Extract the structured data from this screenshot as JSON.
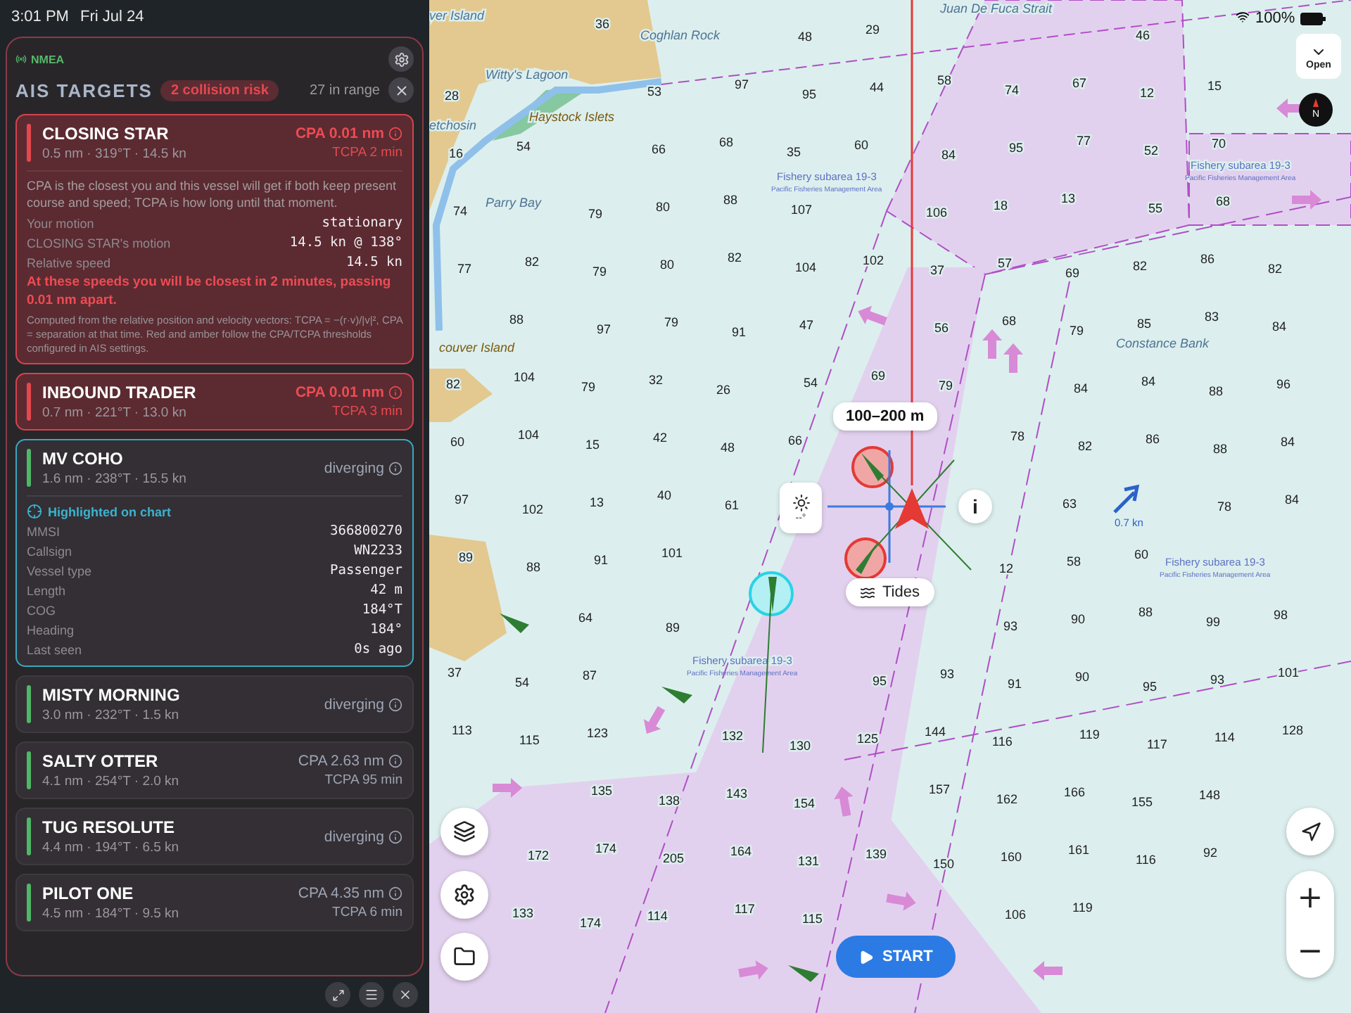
{
  "status_bar": {
    "time": "3:01 PM",
    "date": "Fri Jul 24",
    "battery": "100%"
  },
  "panel": {
    "source": "NMEA",
    "title": "AIS TARGETS",
    "risk_badge": "2 collision risk",
    "range_count": "27 in range"
  },
  "targets": [
    {
      "name": "CLOSING STAR",
      "summary": "0.5 nm · 319°T · 14.5 kn",
      "alert": true,
      "selected": false,
      "cpa": "CPA 0.01 nm",
      "tcpa": "TCPA 2 min",
      "details": {
        "note": "CPA is the closest you and this vessel will get if both keep present course and speed; TCPA is how long until that moment.",
        "rows": [
          {
            "label": "Your motion",
            "value": "stationary"
          },
          {
            "label": "CLOSING STAR's motion",
            "value": "14.5 kn @ 138°"
          },
          {
            "label": "Relative speed",
            "value": "14.5 kn"
          }
        ],
        "warning": "At these speeds you will be closest in 2 minutes, passing 0.01 nm apart.",
        "footnote": "Computed from the relative position and velocity vectors: TCPA = −(r·v)/|v|², CPA = separation at that time. Red and amber follow the CPA/TCPA thresholds configured in AIS settings."
      }
    },
    {
      "name": "INBOUND TRADER",
      "summary": "0.7 nm · 221°T · 13.0 kn",
      "alert": true,
      "selected": false,
      "cpa": "CPA 0.01 nm",
      "tcpa": "TCPA 3 min"
    },
    {
      "name": "MV COHO",
      "summary": "1.6 nm · 238°T · 15.5 kn",
      "alert": false,
      "selected": true,
      "status": "diverging",
      "details": {
        "highlight": "Highlighted on chart",
        "rows": [
          {
            "label": "MMSI",
            "value": "366800270"
          },
          {
            "label": "Callsign",
            "value": "WN2233"
          },
          {
            "label": "Vessel type",
            "value": "Passenger"
          },
          {
            "label": "Length",
            "value": "42 m"
          },
          {
            "label": "COG",
            "value": "184°T"
          },
          {
            "label": "Heading",
            "value": "184°"
          },
          {
            "label": "Last seen",
            "value": "0s ago"
          }
        ]
      }
    },
    {
      "name": "MISTY MORNING",
      "summary": "3.0 nm · 232°T · 1.5 kn",
      "alert": false,
      "selected": false,
      "status": "diverging"
    },
    {
      "name": "SALTY OTTER",
      "summary": "4.1 nm · 254°T · 2.0 kn",
      "alert": false,
      "selected": false,
      "cpa": "CPA 2.63 nm",
      "tcpa": "TCPA 95 min"
    },
    {
      "name": "TUG RESOLUTE",
      "summary": "4.4 nm · 194°T · 6.5 kn",
      "alert": false,
      "selected": false,
      "status": "diverging"
    },
    {
      "name": "PILOT ONE",
      "summary": "4.5 nm · 184°T · 9.5 kn",
      "alert": false,
      "selected": false,
      "cpa": "CPA 4.35 nm",
      "tcpa": "TCPA 6 min"
    }
  ],
  "map": {
    "place_names": [
      "ver Island",
      "Coghlan Rock",
      "Juan De Fuca Strait",
      "Witty's Lagoon",
      "Haystock Islets",
      "etchosin",
      "Parry Bay",
      "couver Island",
      "Constance Bank"
    ],
    "fishery_labels": [
      {
        "title": "Fishery subarea 19-3",
        "subtitle": "Pacific Fisheries Management Area"
      },
      {
        "title": "Fishery subarea 19-3",
        "subtitle": "Pacific Fisheries Management Area"
      },
      {
        "title": "Fishery subarea 19-3",
        "subtitle": "Pacific Fisheries Management Area"
      },
      {
        "title": "Fishery subarea 19-3",
        "subtitle": "Pacific Fisheries Management Area"
      }
    ],
    "soundings": [
      "36",
      "48",
      "29",
      "46",
      "28",
      "53",
      "97",
      "95",
      "44",
      "58",
      "74",
      "67",
      "12",
      "15",
      "16",
      "54",
      "66",
      "68",
      "35",
      "60",
      "84",
      "95",
      "77",
      "52",
      "70",
      "74",
      "79",
      "80",
      "88",
      "107",
      "106",
      "18",
      "13",
      "55",
      "68",
      "77",
      "82",
      "79",
      "80",
      "82",
      "104",
      "102",
      "37",
      "57",
      "69",
      "82",
      "86",
      "82",
      "88",
      "97",
      "79",
      "91",
      "47",
      "56",
      "68",
      "79",
      "85",
      "83",
      "84",
      "82",
      "104",
      "79",
      "32",
      "26",
      "54",
      "69",
      "79",
      "84",
      "84",
      "88",
      "96",
      "60",
      "104",
      "15",
      "42",
      "48",
      "66",
      "78",
      "82",
      "86",
      "88",
      "84",
      "97",
      "102",
      "13",
      "40",
      "61",
      "63",
      "78",
      "84",
      "89",
      "88",
      "91",
      "101",
      "12",
      "58",
      "60",
      "64",
      "89",
      "93",
      "90",
      "88",
      "99",
      "98",
      "37",
      "54",
      "87",
      "95",
      "93",
      "91",
      "90",
      "95",
      "93",
      "101",
      "113",
      "115",
      "123",
      "132",
      "130",
      "125",
      "144",
      "116",
      "119",
      "117",
      "114",
      "128",
      "135",
      "138",
      "143",
      "154",
      "157",
      "162",
      "166",
      "155",
      "148",
      "172",
      "174",
      "205",
      "164",
      "131",
      "139",
      "150",
      "160",
      "161",
      "116",
      "92",
      "133",
      "174",
      "114",
      "117",
      "115",
      "106",
      "119"
    ],
    "speed_label": "0.7 kn",
    "range_label": "100–200 m",
    "tides_button": "Tides",
    "info_button": "i",
    "light_reading": "--°",
    "start_button": "START",
    "zoom_in": "+",
    "zoom_out": "−",
    "open_button": "Open",
    "compass": "N"
  }
}
